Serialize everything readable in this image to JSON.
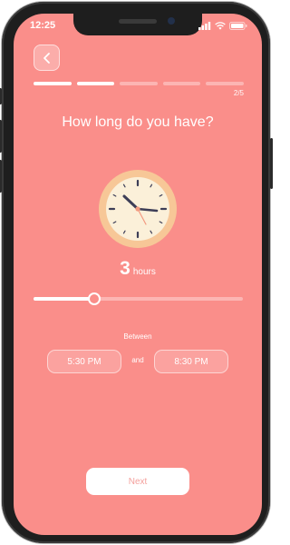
{
  "status_bar": {
    "time": "12:25",
    "icons": [
      "signal-icon",
      "wifi-icon",
      "battery-icon"
    ]
  },
  "header": {
    "back_icon": "chevron-left-icon",
    "progress": {
      "current_step": 2,
      "total_steps": 5
    },
    "step_counter": "2/5"
  },
  "question": "How long do you have?",
  "clock_icon": "clock-icon",
  "duration": {
    "value": "3",
    "unit": "hours"
  },
  "slider": {
    "value_fraction": 0.29
  },
  "range": {
    "label": "Between",
    "start": "5:30 PM",
    "connector": "and",
    "end": "8:30 PM"
  },
  "next_button": "Next",
  "colors": {
    "background": "#fa8e8a",
    "clock_face": "#fbf0d9",
    "clock_ring": "#f7c797",
    "hands": "#3d3e57",
    "next_text": "#f4a19d"
  }
}
